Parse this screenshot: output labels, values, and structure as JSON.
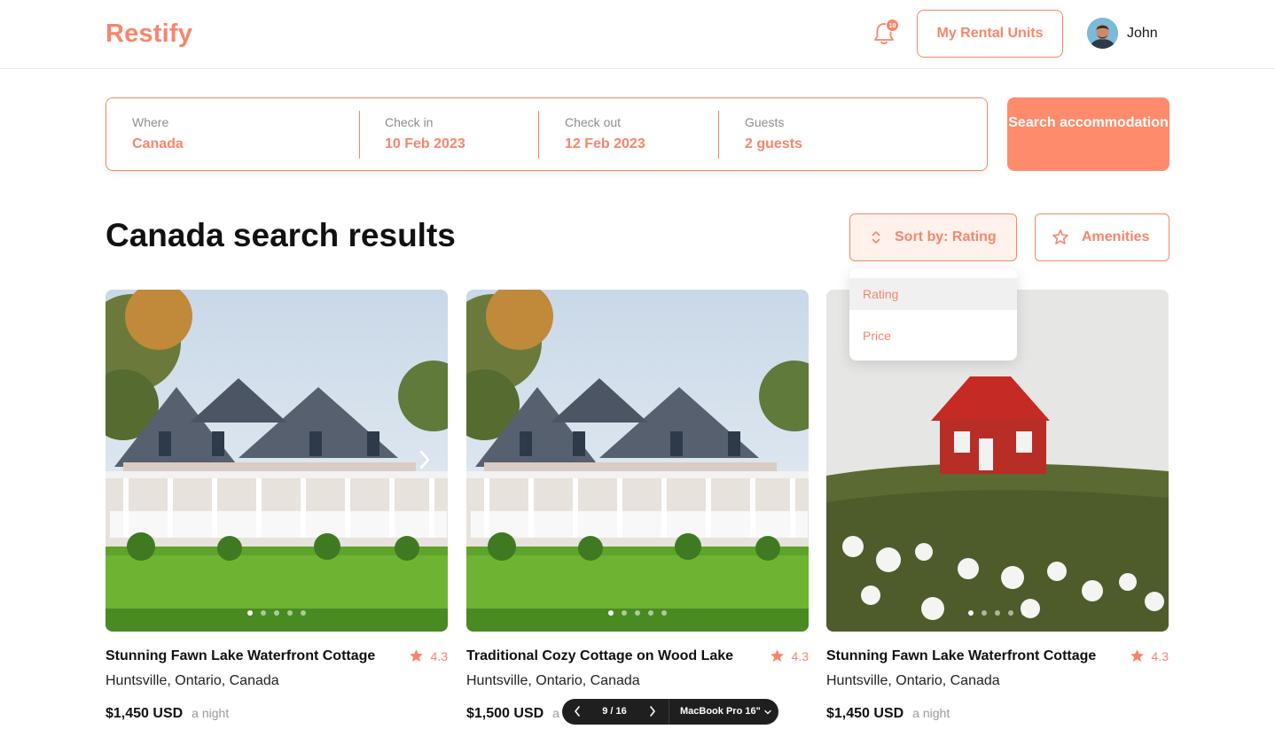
{
  "header": {
    "logo": "Restify",
    "notification_count": "10",
    "rental_units_label": "My Rental Units",
    "user_name": "John"
  },
  "search": {
    "where": {
      "label": "Where",
      "value": "Canada"
    },
    "check_in": {
      "label": "Check in",
      "value": "10 Feb 2023"
    },
    "check_out": {
      "label": "Check out",
      "value": "12 Feb 2023"
    },
    "guests": {
      "label": "Guests",
      "value": "2 guests"
    },
    "button_label": "Search accommodation"
  },
  "results": {
    "title": "Canada search results",
    "sort_label": "Sort by: Rating",
    "amenities_label": "Amenities",
    "sort_options": [
      "Rating",
      "Price"
    ],
    "sort_selected": "Rating"
  },
  "cards": [
    {
      "title": "Stunning Fawn Lake Waterfront Cottage",
      "rating": "4.3",
      "location": "Huntsville, Ontario, Canada",
      "price": "$1,450 USD",
      "per": "a night",
      "image": "white-cottage",
      "dots": 5,
      "active_dot": 1
    },
    {
      "title": "Traditional Cozy Cottage on Wood Lake",
      "rating": "4.3",
      "location": "Huntsville, Ontario, Canada",
      "price": "$1,500 USD",
      "per": "a night",
      "image": "white-cottage",
      "dots": 5,
      "active_dot": 1
    },
    {
      "title": "Stunning Fawn Lake Waterfront Cottage",
      "rating": "4.3",
      "location": "Huntsville, Ontario, Canada",
      "price": "$1,450 USD",
      "per": "a night",
      "image": "red-cabin",
      "dots": 5,
      "active_dot": 1
    }
  ],
  "toolbar": {
    "page": "9 / 16",
    "device": "MacBook Pro 16\""
  },
  "colors": {
    "accent": "#f7866b",
    "button": "#fe8b6b",
    "toolbar": "#1f1f1f"
  }
}
